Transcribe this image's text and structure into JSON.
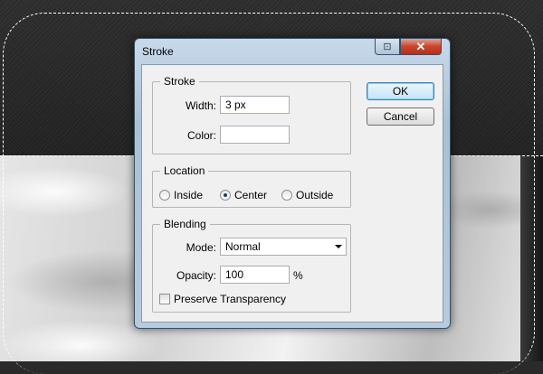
{
  "dialog": {
    "title": "Stroke",
    "help_glyph": "⊡",
    "close_glyph": "✕"
  },
  "stroke": {
    "legend": "Stroke",
    "width_label": "Width:",
    "width_value": "3 px",
    "color_label": "Color:",
    "color_value": "#ffffff"
  },
  "location": {
    "legend": "Location",
    "options": [
      {
        "label": "Inside",
        "selected": false
      },
      {
        "label": "Center",
        "selected": true
      },
      {
        "label": "Outside",
        "selected": false
      }
    ]
  },
  "blending": {
    "legend": "Blending",
    "mode_label": "Mode:",
    "mode_value": "Normal",
    "opacity_label": "Opacity:",
    "opacity_value": "100",
    "opacity_unit": "%",
    "preserve_label": "Preserve Transparency",
    "preserve_checked": false
  },
  "buttons": {
    "ok": "OK",
    "cancel": "Cancel"
  }
}
